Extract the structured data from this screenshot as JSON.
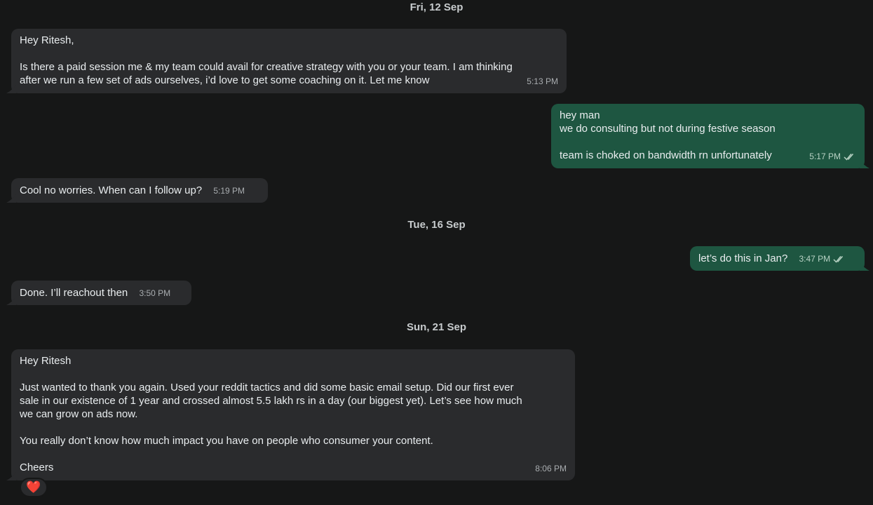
{
  "dates": {
    "d1": "Fri, 12 Sep",
    "d2": "Tue, 16 Sep",
    "d3": "Sun, 21 Sep"
  },
  "messages": [
    {
      "direction": "incoming",
      "text": "Hey Ritesh,\n\nIs there a paid session me & my team could avail for creative strategy with you or your team. I am thinking\nafter we run a few set of ads ourselves, i’d love to get some coaching on it. Let me know",
      "time": "5:13 PM"
    },
    {
      "direction": "outgoing",
      "text": "hey man\nwe do consulting but not during festive season\n\nteam is choked on bandwidth rn unfortunately",
      "time": "5:17 PM",
      "status_icon": "double-check-icon"
    },
    {
      "direction": "incoming",
      "text": "Cool no worries. When can I follow up?",
      "time": "5:19 PM"
    },
    {
      "direction": "outgoing",
      "text": "let’s do this in Jan?",
      "time": "3:47 PM",
      "status_icon": "double-check-icon"
    },
    {
      "direction": "incoming",
      "text": "Done. I’ll reachout then",
      "time": "3:50 PM"
    },
    {
      "direction": "incoming",
      "text": "Hey Ritesh\n\nJust wanted to thank you again. Used your reddit tactics and did some basic email setup. Did our first ever\nsale in our existence of 1 year and crossed almost 5.5 lakh rs in a day (our biggest yet). Let’s see how much\nwe can grow on ads now.\n\nYou really don’t know how much impact you have on people who consumer your content.\n\nCheers",
      "time": "8:06 PM",
      "reaction": "❤️"
    }
  ],
  "colors": {
    "background": "#161717",
    "incoming_bubble": "#2a2b2d",
    "outgoing_bubble": "#1e5641",
    "tick": "#b8d2c4"
  }
}
